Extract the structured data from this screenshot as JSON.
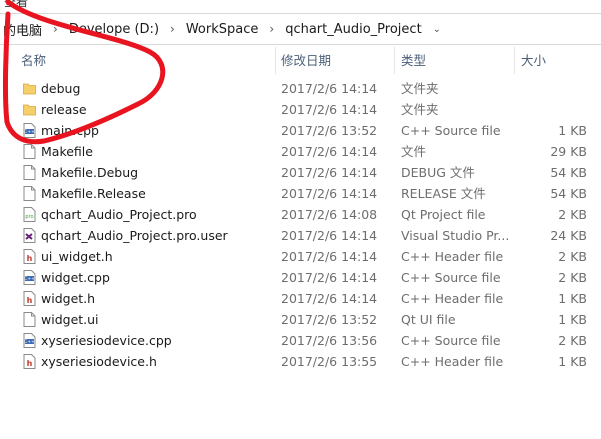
{
  "menu": {
    "partial_label": "查看"
  },
  "breadcrumb": {
    "items": [
      "的电脑",
      "Develope (D:)",
      "WorkSpace",
      "qchart_Audio_Project"
    ],
    "separator": "›",
    "dropdown": "⌄"
  },
  "columns": {
    "name": "名称",
    "date": "修改日期",
    "type": "类型",
    "size": "大小"
  },
  "files": [
    {
      "name": "debug",
      "date": "2017/2/6 14:14",
      "type": "文件夹",
      "size": "",
      "icon": "folder-icon"
    },
    {
      "name": "release",
      "date": "2017/2/6 14:14",
      "type": "文件夹",
      "size": "",
      "icon": "folder-icon"
    },
    {
      "name": "main.cpp",
      "date": "2017/2/6 13:52",
      "type": "C++ Source file",
      "size": "1 KB",
      "icon": "cpp-source-icon"
    },
    {
      "name": "Makefile",
      "date": "2017/2/6 14:14",
      "type": "文件",
      "size": "29 KB",
      "icon": "blank-file-icon"
    },
    {
      "name": "Makefile.Debug",
      "date": "2017/2/6 14:14",
      "type": "DEBUG 文件",
      "size": "54 KB",
      "icon": "blank-file-icon"
    },
    {
      "name": "Makefile.Release",
      "date": "2017/2/6 14:14",
      "type": "RELEASE 文件",
      "size": "54 KB",
      "icon": "blank-file-icon"
    },
    {
      "name": "qchart_Audio_Project.pro",
      "date": "2017/2/6 14:08",
      "type": "Qt Project file",
      "size": "2 KB",
      "icon": "qt-project-icon"
    },
    {
      "name": "qchart_Audio_Project.pro.user",
      "date": "2017/2/6 14:14",
      "type": "Visual Studio Pr...",
      "size": "24 KB",
      "icon": "visual-studio-icon"
    },
    {
      "name": "ui_widget.h",
      "date": "2017/2/6 14:14",
      "type": "C++ Header file",
      "size": "2 KB",
      "icon": "cpp-header-icon"
    },
    {
      "name": "widget.cpp",
      "date": "2017/2/6 14:14",
      "type": "C++ Source file",
      "size": "2 KB",
      "icon": "cpp-source-icon"
    },
    {
      "name": "widget.h",
      "date": "2017/2/6 14:14",
      "type": "C++ Header file",
      "size": "1 KB",
      "icon": "cpp-header-icon"
    },
    {
      "name": "widget.ui",
      "date": "2017/2/6 13:52",
      "type": "Qt UI file",
      "size": "1 KB",
      "icon": "blank-file-icon"
    },
    {
      "name": "xyseriesiodevice.cpp",
      "date": "2017/2/6 13:56",
      "type": "C++ Source file",
      "size": "2 KB",
      "icon": "cpp-source-icon"
    },
    {
      "name": "xyseriesiodevice.h",
      "date": "2017/2/6 13:55",
      "type": "C++ Header file",
      "size": "1 KB",
      "icon": "cpp-header-icon"
    }
  ],
  "colors": {
    "folder": "#f5cf6b",
    "annotation": "#e8141f",
    "header_text": "#4c607a"
  }
}
